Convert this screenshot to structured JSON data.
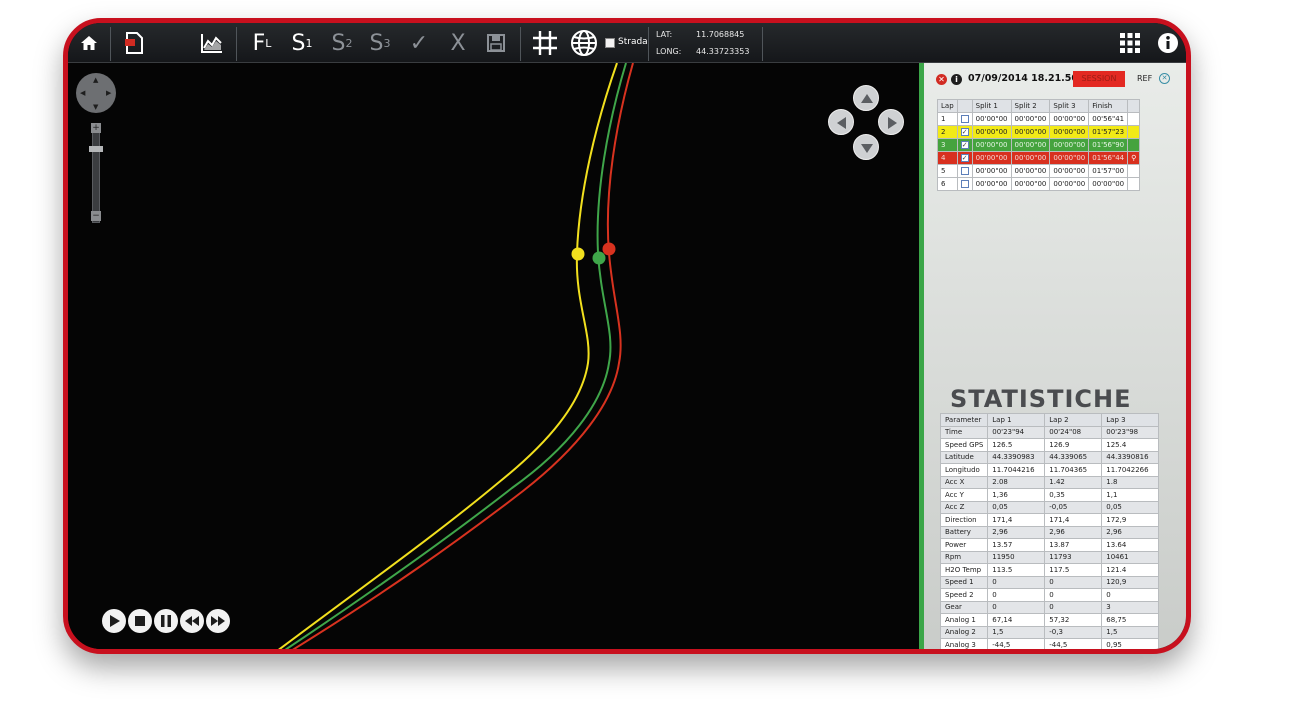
{
  "toolbar": {
    "f_letter": "F",
    "f_sub": "L",
    "s1_letter": "S",
    "s1_sub": "1",
    "s2_letter": "S",
    "s2_sub": "2",
    "s3_letter": "S",
    "s3_sub": "3",
    "check": "✓",
    "cross": "X",
    "strada_label": "Strada",
    "lat_label": "LAT:",
    "lat_value": "11.7068845",
    "long_label": "LONG:",
    "long_value": "44.33723353"
  },
  "map": {
    "track_colors": {
      "yellow": "#f2e01e",
      "green": "#3fa64a",
      "red": "#d8321f"
    }
  },
  "session": {
    "date": "07/09/2014 18.21.50",
    "button": "SESSION",
    "ref_label": "REF"
  },
  "laps": {
    "headers": [
      "Lap",
      "",
      "Split 1",
      "Split 2",
      "Split 3",
      "Finish",
      ""
    ],
    "rows": [
      {
        "lap": "1",
        "checked": false,
        "split1": "00'00\"00",
        "split2": "00'00\"00",
        "split3": "00'00\"00",
        "finish": "00'56\"41",
        "color": "none"
      },
      {
        "lap": "2",
        "checked": true,
        "split1": "00'00\"00",
        "split2": "00'00\"00",
        "split3": "00'00\"00",
        "finish": "01'57\"23",
        "color": "yellow"
      },
      {
        "lap": "3",
        "checked": true,
        "split1": "00'00\"00",
        "split2": "00'00\"00",
        "split3": "00'00\"00",
        "finish": "01'56\"90",
        "color": "green"
      },
      {
        "lap": "4",
        "checked": true,
        "split1": "00'00\"00",
        "split2": "00'00\"00",
        "split3": "00'00\"00",
        "finish": "01'56\"44",
        "color": "red"
      },
      {
        "lap": "5",
        "checked": false,
        "split1": "00'00\"00",
        "split2": "00'00\"00",
        "split3": "00'00\"00",
        "finish": "01'57\"00",
        "color": "none"
      },
      {
        "lap": "6",
        "checked": false,
        "split1": "00'00\"00",
        "split2": "00'00\"00",
        "split3": "00'00\"00",
        "finish": "00'00\"00",
        "color": "none"
      }
    ]
  },
  "stats": {
    "title": "STATISTICHE",
    "headers": [
      "Parameter",
      "Lap 1",
      "Lap 2",
      "Lap 3"
    ],
    "rows": [
      [
        "Time",
        "00'23\"94",
        "00'24\"08",
        "00'23\"98"
      ],
      [
        "Speed GPS",
        "126.5",
        "126.9",
        "125.4"
      ],
      [
        "Latitude",
        "44.3390983",
        "44.339065",
        "44.3390816"
      ],
      [
        "Longitudo",
        "11.7044216",
        "11.704365",
        "11.7042266"
      ],
      [
        "Acc X",
        "2.08",
        "1.42",
        "1.8"
      ],
      [
        "Acc Y",
        "1,36",
        "0,35",
        "1,1"
      ],
      [
        "Acc Z",
        "0,05",
        "-0,05",
        "0,05"
      ],
      [
        "Direction",
        "171,4",
        "171,4",
        "172,9"
      ],
      [
        "Battery",
        "2,96",
        "2,96",
        "2,96"
      ],
      [
        "Power",
        "13.57",
        "13.87",
        "13.64"
      ],
      [
        "Rpm",
        "11950",
        "11793",
        "10461"
      ],
      [
        "H2O Temp",
        "113.5",
        "117.5",
        "121.4"
      ],
      [
        "Speed 1",
        "0",
        "0",
        "120,9"
      ],
      [
        "Speed 2",
        "0",
        "0",
        "0"
      ],
      [
        "Gear",
        "0",
        "0",
        "3"
      ],
      [
        "Analog 1",
        "67,14",
        "57,32",
        "68,75"
      ],
      [
        "Analog 2",
        "1,5",
        "-0,3",
        "1,5"
      ],
      [
        "Analog 3",
        "-44,5",
        "-44,5",
        "0,95"
      ]
    ]
  }
}
